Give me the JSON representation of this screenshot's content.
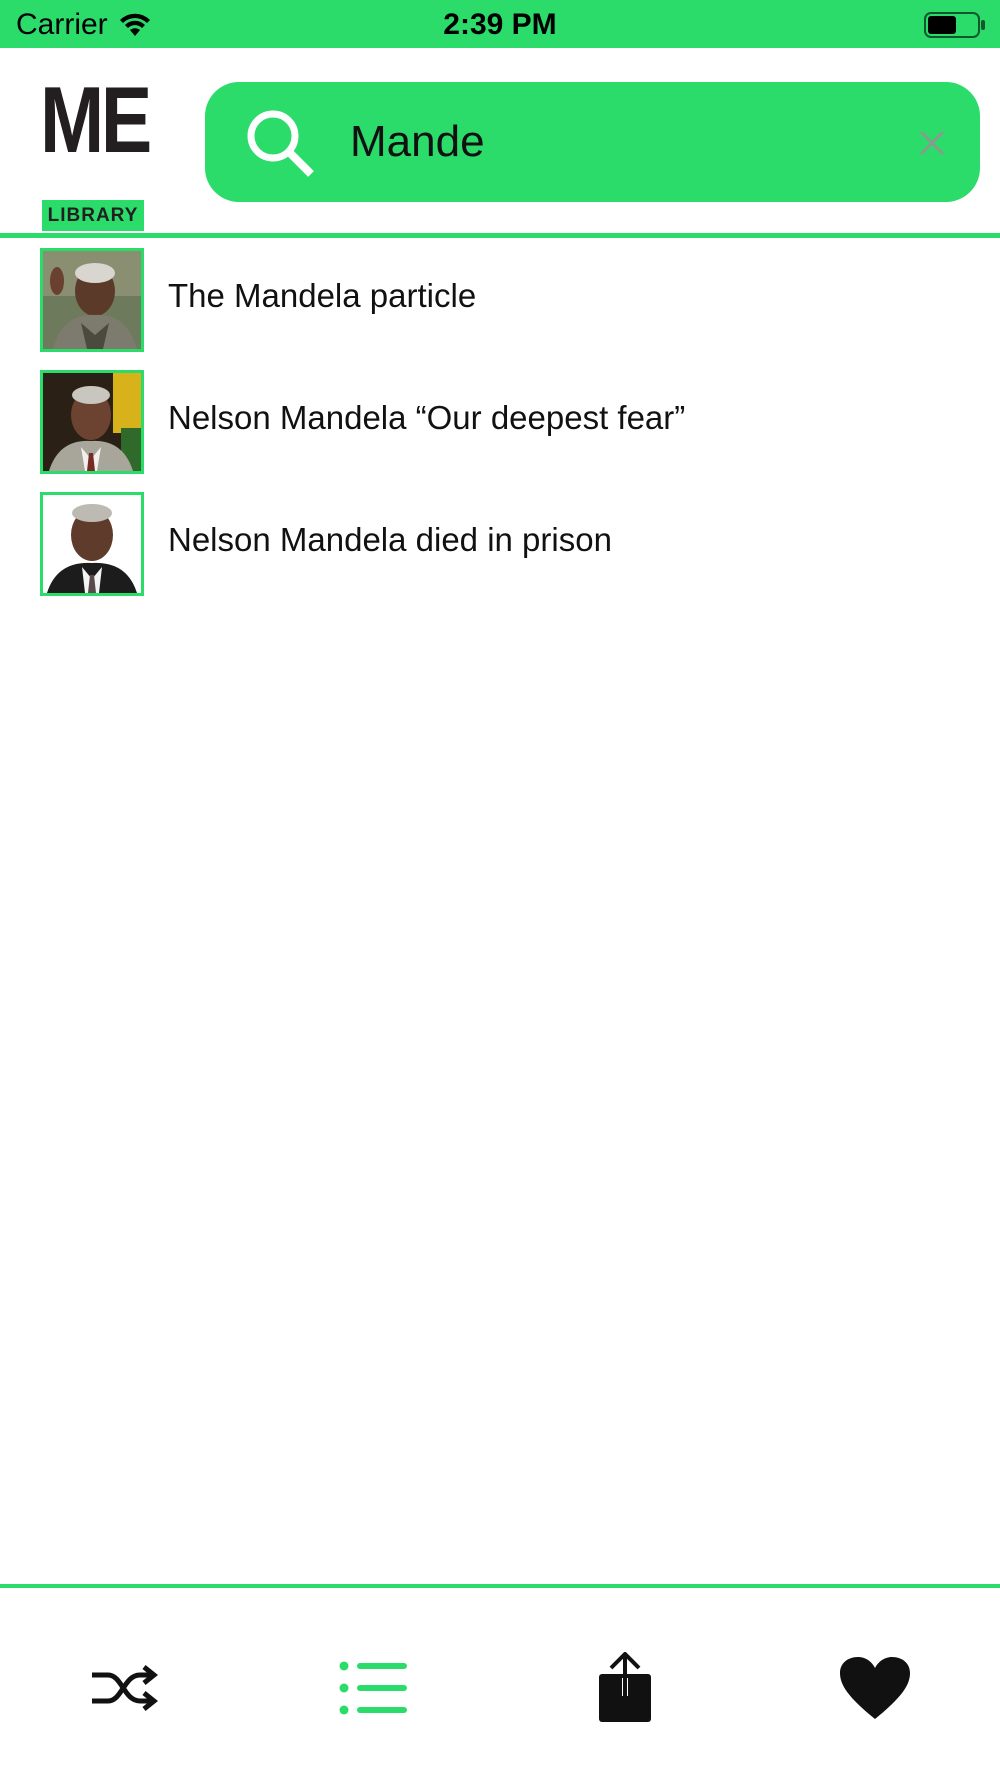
{
  "status_bar": {
    "carrier": "Carrier",
    "time": "2:39 PM"
  },
  "logo": {
    "top_text": "ME",
    "bottom_text": "LIBRARY"
  },
  "search": {
    "value": "Mande"
  },
  "results": [
    {
      "title": "The Mandela particle"
    },
    {
      "title": "Nelson Mandela “Our deepest fear”"
    },
    {
      "title": "Nelson Mandela died in prison"
    }
  ],
  "tab_bar": {
    "items": [
      {
        "icon": "shuffle-icon"
      },
      {
        "icon": "list-icon",
        "active": true
      },
      {
        "icon": "share-icon"
      },
      {
        "icon": "heart-icon"
      }
    ]
  },
  "colors": {
    "accent": "#2bdc6a",
    "text": "#111111"
  }
}
